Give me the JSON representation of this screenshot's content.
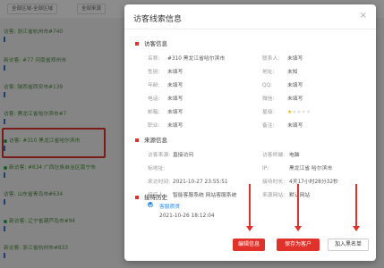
{
  "background": {
    "filters": [
      "全部区域-全部区域",
      "全部来源"
    ],
    "items": [
      {
        "text": "访客: 浙江省杭州市#740",
        "dot": false
      },
      {
        "text": "新访客: #77 河南省郑州市",
        "dot": false
      },
      {
        "text": "访客: 陕西省西安市#139",
        "dot": false
      },
      {
        "text": "访客: 黑龙江省哈尔滨市#7",
        "dot": false
      },
      {
        "text": "访客: #310 黑龙江省哈尔滨市",
        "dot": true
      },
      {
        "text": "新访客: #634 广西壮族自治区南宁市",
        "dot": true
      },
      {
        "text": "访客: 山东省青岛市#634",
        "dot": false
      },
      {
        "text": "新访客: 辽宁省葫芦岛市#94",
        "dot": true
      },
      {
        "text": "新访客: 浙江省杭州市#833",
        "dot": false
      }
    ]
  },
  "modal": {
    "title": "访客线索信息",
    "close": "×",
    "visitor_section": "访客信息",
    "visitor_fields_left": [
      {
        "label": "名称:",
        "value": "#310 黑龙江省哈尔滨市"
      },
      {
        "label": "性别:",
        "value": "未填写"
      },
      {
        "label": "年龄:",
        "value": "未填写"
      },
      {
        "label": "电话:",
        "value": "未填写"
      },
      {
        "label": "邮箱:",
        "value": "未填写"
      },
      {
        "label": "职业:",
        "value": "未填写"
      }
    ],
    "visitor_fields_right": [
      {
        "label": "联系人:",
        "value": "未填写"
      },
      {
        "label": "地址:",
        "value": "未知"
      },
      {
        "label": "QQ:",
        "value": "未填写"
      },
      {
        "label": "微信:",
        "value": "未填写"
      },
      {
        "label": "星级:",
        "stars": 1,
        "max": 5
      },
      {
        "label": "备注:",
        "value": "未填写"
      }
    ],
    "source_section": "来源信息",
    "source_fields_left": [
      {
        "label": "访客来源:",
        "value": "直接访问"
      },
      {
        "label": "标地址:",
        "value": ""
      },
      {
        "label": "来访时间:",
        "value": "2021-10-27 23:55:51"
      },
      {
        "label": "接待人:",
        "value": "智能客服系统 网站客服系统"
      }
    ],
    "source_fields_right": [
      {
        "label": "访客终端:",
        "value": "电脑"
      },
      {
        "label": "IP:",
        "value": "黑龙江省 哈尔滨市"
      },
      {
        "label": "接待时长:",
        "value": "4天17小时28分32秒"
      },
      {
        "label": "来源网站:",
        "value": "默认网站"
      }
    ],
    "history_section": "接待历史",
    "history": [
      {
        "agent": "客服质贤",
        "time": "2021-10-26 18:12:04"
      }
    ],
    "buttons": {
      "edit": "编辑信息",
      "save": "保存为客户",
      "blacklist": "加入黑名单"
    }
  },
  "colors": {
    "accent_red": "#e0322a",
    "star": "#f5b400",
    "online_green": "#2eaa4e"
  }
}
